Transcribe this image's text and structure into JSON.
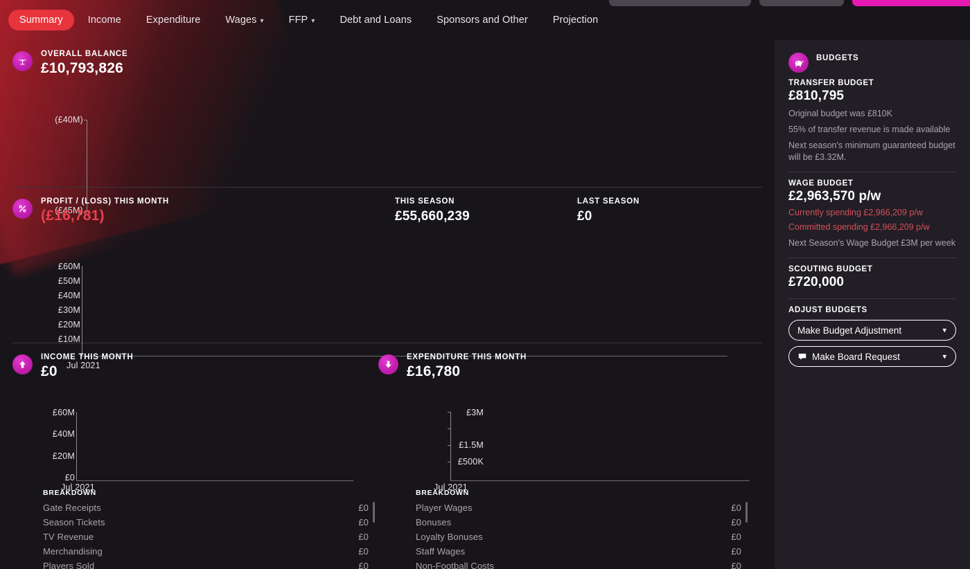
{
  "tabs": [
    {
      "label": "Summary",
      "active": true,
      "caret": false
    },
    {
      "label": "Income",
      "active": false,
      "caret": false
    },
    {
      "label": "Expenditure",
      "active": false,
      "caret": false
    },
    {
      "label": "Wages",
      "active": false,
      "caret": true
    },
    {
      "label": "FFP",
      "active": false,
      "caret": true
    },
    {
      "label": "Debt and Loans",
      "active": false,
      "caret": false
    },
    {
      "label": "Sponsors and Other",
      "active": false,
      "caret": false
    },
    {
      "label": "Projection",
      "active": false,
      "caret": false
    }
  ],
  "accent": {
    "tab_active_bg": "#e8343c",
    "badge_pink": "#c21fae",
    "negative_red": "#e8434f",
    "sidebar_warn_red": "#d3505e"
  },
  "overall_balance": {
    "label": "Overall Balance",
    "value": "£10,793,826",
    "icon": "balance-scales-icon"
  },
  "profit_loss": {
    "label": "Profit / (Loss) This Month",
    "value": "(£16,781)",
    "icon": "percent-icon",
    "this_season_label": "This Season",
    "this_season_value": "£55,660,239",
    "last_season_label": "Last Season",
    "last_season_value": "£0"
  },
  "income": {
    "label": "Income This Month",
    "value": "£0",
    "icon": "arrow-up-icon",
    "breakdown_title": "Breakdown",
    "breakdown": [
      {
        "name": "Gate Receipts",
        "value": "£0"
      },
      {
        "name": "Season Tickets",
        "value": "£0"
      },
      {
        "name": "TV Revenue",
        "value": "£0"
      },
      {
        "name": "Merchandising",
        "value": "£0"
      },
      {
        "name": "Players Sold",
        "value": "£0"
      }
    ]
  },
  "expenditure": {
    "label": "Expenditure This Month",
    "value": "£16,780",
    "icon": "arrow-down-icon",
    "breakdown_title": "Breakdown",
    "breakdown": [
      {
        "name": "Player Wages",
        "value": "£0"
      },
      {
        "name": "Bonuses",
        "value": "£0"
      },
      {
        "name": "Loyalty Bonuses",
        "value": "£0"
      },
      {
        "name": "Staff Wages",
        "value": "£0"
      },
      {
        "name": "Non-Football Costs",
        "value": "£0"
      }
    ]
  },
  "sidebar": {
    "title": "Budgets",
    "icon": "piggy-bank-icon",
    "transfer_budget": {
      "label": "Transfer Budget",
      "value": "£810,795",
      "notes": [
        "Original budget was £810K",
        "55% of transfer revenue is made available",
        "Next season's minimum guaranteed budget will be £3.32M."
      ]
    },
    "wage_budget": {
      "label": "Wage Budget",
      "value": "£2,963,570 p/w",
      "warnings": [
        "Currently spending £2,966,209 p/w",
        "Committed spending £2,966,209 p/w"
      ],
      "notes": [
        "Next Season's Wage Budget £3M per week"
      ]
    },
    "scouting_budget": {
      "label": "Scouting Budget",
      "value": "£720,000"
    },
    "adjust": {
      "label": "Adjust Budgets",
      "budget_adjustment": "Make Budget Adjustment",
      "board_request": "Make Board Request"
    }
  },
  "chart_data": [
    {
      "type": "line",
      "title": "Overall Balance",
      "x": [
        "Jul 2021"
      ],
      "series": [
        {
          "name": "Overall Balance",
          "values": [
            10793826
          ]
        }
      ],
      "ytick_labels": [
        "(£40M)",
        "(£45M)"
      ],
      "ylim": [
        -45000000,
        -40000000
      ],
      "xlabel": "",
      "ylabel": "",
      "grid": false,
      "legend": "none"
    },
    {
      "type": "line",
      "title": "Profit / (Loss) This Month",
      "x": [
        "Jul 2021"
      ],
      "xtick_labels": [
        "Jul 2021"
      ],
      "series": [
        {
          "name": "Profit / (Loss)",
          "values": [
            -16781
          ]
        }
      ],
      "ytick_labels": [
        "£60M",
        "£50M",
        "£40M",
        "£30M",
        "£20M",
        "£10M"
      ],
      "ylim": [
        0,
        60000000
      ],
      "xlabel": "",
      "ylabel": "",
      "grid": false,
      "legend": "none"
    },
    {
      "type": "line",
      "title": "Income This Month",
      "x": [
        "Jul 2021"
      ],
      "xtick_labels": [
        "Jul 2021"
      ],
      "series": [
        {
          "name": "Income",
          "values": [
            0
          ]
        }
      ],
      "ytick_labels": [
        "£60M",
        "£40M",
        "£20M",
        "£0"
      ],
      "ylim": [
        0,
        60000000
      ],
      "xlabel": "",
      "ylabel": "",
      "grid": false,
      "legend": "none"
    },
    {
      "type": "line",
      "title": "Expenditure This Month",
      "x": [
        "Jul 2021"
      ],
      "xtick_labels": [
        "Jul 2021"
      ],
      "series": [
        {
          "name": "Expenditure",
          "values": [
            16780
          ]
        }
      ],
      "ytick_labels": [
        "£3M",
        "£1.5M",
        "£500K"
      ],
      "ylim": [
        0,
        3000000
      ],
      "xlabel": "",
      "ylabel": "",
      "grid": false,
      "legend": "none"
    }
  ]
}
